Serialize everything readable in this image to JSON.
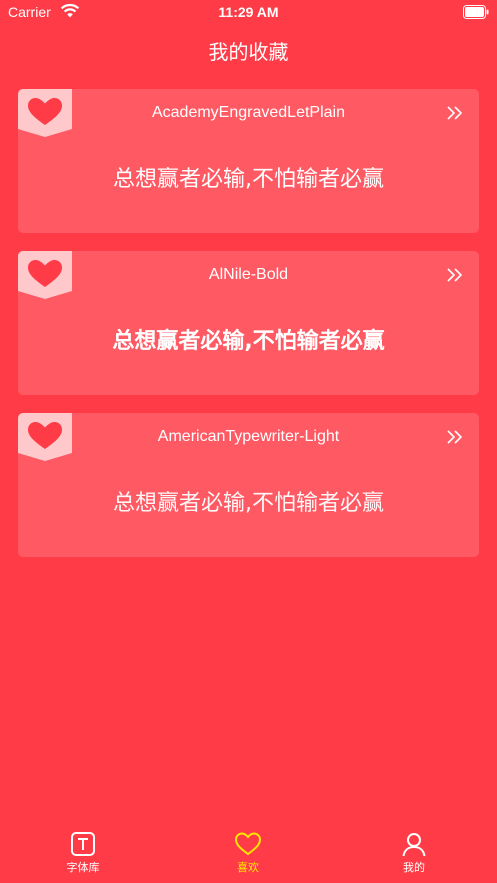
{
  "status_bar": {
    "carrier": "Carrier",
    "time": "11:29 AM"
  },
  "nav": {
    "title": "我的收藏"
  },
  "favorites": [
    {
      "font_name": "AcademyEngravedLetPlain",
      "sample_text": "总想赢者必输,不怕输者必赢",
      "badge_icon": "heart-icon",
      "action_icon": "double-chevron-right-icon"
    },
    {
      "font_name": "AlNile-Bold",
      "sample_text": "总想赢者必输,不怕输者必赢",
      "badge_icon": "heart-icon",
      "action_icon": "double-chevron-right-icon"
    },
    {
      "font_name": "AmericanTypewriter-Light",
      "sample_text": "总想赢者必输,不怕输者必赢",
      "badge_icon": "heart-icon",
      "action_icon": "double-chevron-right-icon"
    }
  ],
  "tab_bar": {
    "tabs": [
      {
        "label": "字体库",
        "icon": "text-box-icon",
        "active": false
      },
      {
        "label": "喜欢",
        "icon": "heart-outline-icon",
        "active": true
      },
      {
        "label": "我的",
        "icon": "person-icon",
        "active": false
      }
    ]
  },
  "colors": {
    "background": "#FF3B47",
    "active_tab": "#FFE600",
    "badge": "#FFC9CC",
    "heart": "#FF3B47"
  }
}
